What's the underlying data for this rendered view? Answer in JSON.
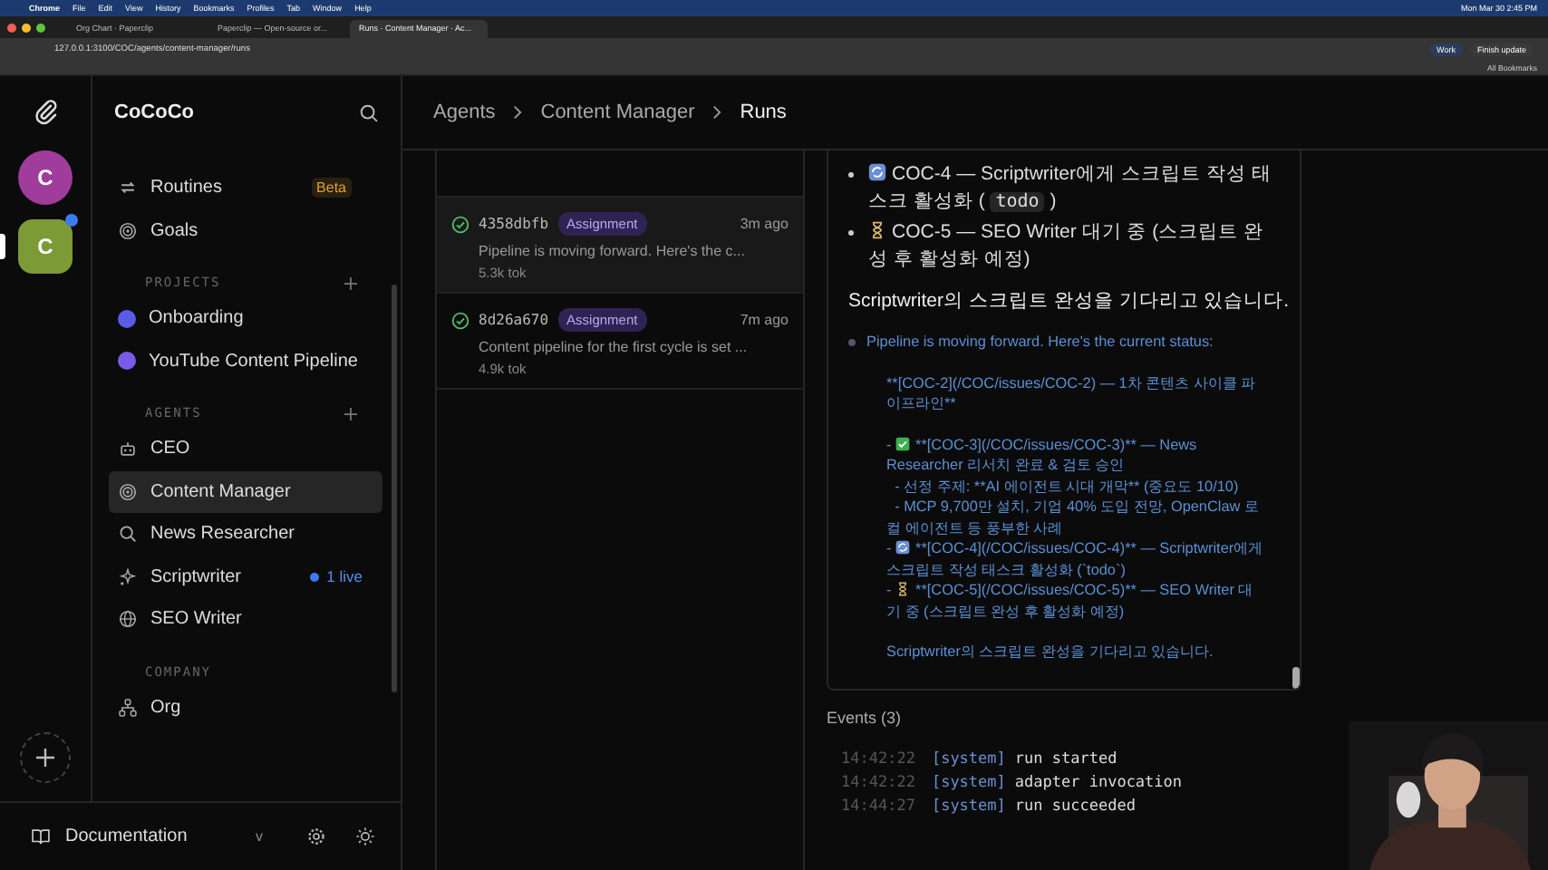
{
  "menu_bar": {
    "items": [
      "Chrome",
      "File",
      "Edit",
      "View",
      "History",
      "Bookmarks",
      "Profiles",
      "Tab",
      "Window",
      "Help"
    ],
    "clock": "Mon Mar 30  2:45 PM"
  },
  "browser": {
    "tabs": [
      {
        "label": "Org Chart · Paperclip",
        "selected": false
      },
      {
        "label": "Paperclip — Open-source or...",
        "selected": false
      },
      {
        "label": "Runs · Content Manager · Ac...",
        "selected": true
      }
    ],
    "address": "127.0.0.1:3100/COC/agents/content-manager/runs",
    "buttons": [
      {
        "label": "Work",
        "kind": "profile"
      },
      {
        "label": "Finish update",
        "kind": "update"
      }
    ],
    "all_bookmarks": "All Bookmarks"
  },
  "rail": {
    "companies": [
      {
        "letter": "C",
        "color": "#a03c9c",
        "selected": false,
        "unread": false
      },
      {
        "letter": "C",
        "color": "#7c9a36",
        "selected": true,
        "unread": true
      }
    ]
  },
  "sidebar": {
    "title": "CoCoCo",
    "nav": [
      {
        "label": "Routines",
        "badge": "Beta"
      },
      {
        "label": "Goals"
      }
    ],
    "projects": {
      "heading": "PROJECTS",
      "items": [
        {
          "label": "Onboarding",
          "color": "#5a5ce6"
        },
        {
          "label": "YouTube Content Pipeline",
          "color": "#7a5ae8"
        }
      ]
    },
    "agents": {
      "heading": "AGENTS",
      "items": [
        {
          "label": "CEO",
          "selected": false
        },
        {
          "label": "Content Manager",
          "selected": true
        },
        {
          "label": "News Researcher",
          "selected": false
        },
        {
          "label": "Scriptwriter",
          "selected": false,
          "live": "1 live"
        },
        {
          "label": "SEO Writer",
          "selected": false
        }
      ]
    },
    "company": {
      "heading": "COMPANY",
      "items": [
        {
          "label": "Org"
        }
      ]
    },
    "footer": {
      "label": "Documentation",
      "version": "v"
    }
  },
  "breadcrumb": [
    "Agents",
    "Content Manager",
    "Runs"
  ],
  "runs": [
    {
      "id": "4358dbfb",
      "tag": "Assignment",
      "time": "3m ago",
      "summary": "Pipeline is moving forward. Here's the c...",
      "tokens": "5.3k tok",
      "selected": true
    },
    {
      "id": "8d26a670",
      "tag": "Assignment",
      "time": "7m ago",
      "summary": "Content pipeline for the first cycle is set ...",
      "tokens": "4.9k tok",
      "selected": false
    }
  ],
  "detail": {
    "bullets": [
      {
        "before": "COC-4 — Scriptwriter에게 스크립트 작성 태스크 활성화 ( ",
        "code": "todo",
        "after": " )"
      },
      {
        "before": "COC-5 — SEO Writer 대기 중 (스크립트 완성 후 활성화 예정)"
      }
    ],
    "paragraph": "Scriptwriter의 스크립트 완성을 기다리고 있습니다.",
    "raw_first": "Pipeline is moving forward. Here's the current status:",
    "raw_blocks": [
      [
        {
          "kind": "plain",
          "text": "**[COC-2](/COC/issues/COC-2) — 1차 콘텐츠 사이클 파이프라인**"
        }
      ],
      [
        {
          "kind": "check",
          "prefix": "- ",
          "text": "**[COC-3](/COC/issues/COC-3)** — News Researcher 리서치 완료 & 검토 승인"
        },
        {
          "kind": "plain",
          "text": "  - 선정 주제: **AI 에이전트 시대 개막** (중요도 10/10)"
        },
        {
          "kind": "plain",
          "text": "  - MCP 9,700만 설치, 기업 40% 도입 전망, OpenClaw 로컬 에이전트 등 풍부한 사례"
        },
        {
          "kind": "refresh",
          "prefix": "- ",
          "text": "**[COC-4](/COC/issues/COC-4)** — Scriptwriter에게 스크립트 작성 태스크 활성화 (`todo`)"
        },
        {
          "kind": "hourglass",
          "prefix": "- ",
          "text": "**[COC-5](/COC/issues/COC-5)** — SEO Writer 대기 중 (스크립트 완성 후 활성화 예정)"
        }
      ],
      [
        {
          "kind": "plain",
          "text": "Scriptwriter의 스크립트 완성을 기다리고 있습니다."
        }
      ]
    ]
  },
  "events": {
    "title": "Events (3)",
    "rows": [
      {
        "time": "14:42:22",
        "source": "[system]",
        "message": "run started"
      },
      {
        "time": "14:42:22",
        "source": "[system]",
        "message": "adapter invocation"
      },
      {
        "time": "14:44:27",
        "source": "[system]",
        "message": "run succeeded"
      }
    ]
  }
}
